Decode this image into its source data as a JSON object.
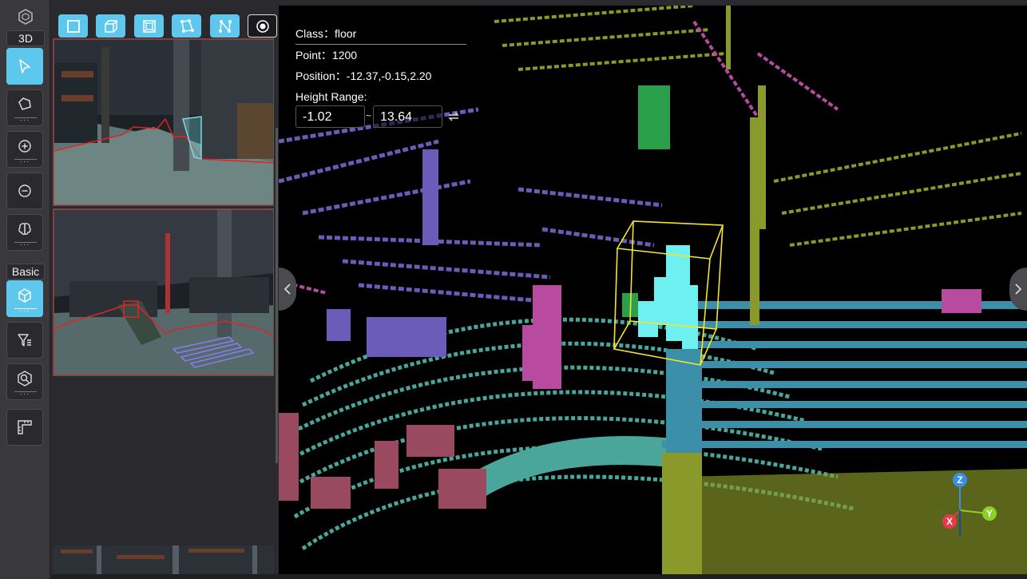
{
  "toolbar": {
    "section_3d": "3D",
    "section_basic": "Basic",
    "more": "···"
  },
  "info": {
    "class_label": "Class：floor",
    "point_label": "Point：1200",
    "position_label": "Position：-12.37,-0.15,2.20",
    "height_range_label": "Height Range:",
    "height_min": "-1.02",
    "height_sep": "~",
    "height_max": "13.64"
  },
  "axes": {
    "z": "Z",
    "y": "Y",
    "x": "X"
  },
  "colors": {
    "accent": "#5ec7ee",
    "annotation_red": "#e02424",
    "box_yellow": "#f5e52a",
    "floor_teal": "#4aa59a",
    "wall_purple": "#6a5cb8",
    "olive": "#8a9a2a",
    "magenta": "#b84aa0",
    "cyan_object": "#6ff0f0",
    "steel_blue": "#3b8fa8"
  }
}
